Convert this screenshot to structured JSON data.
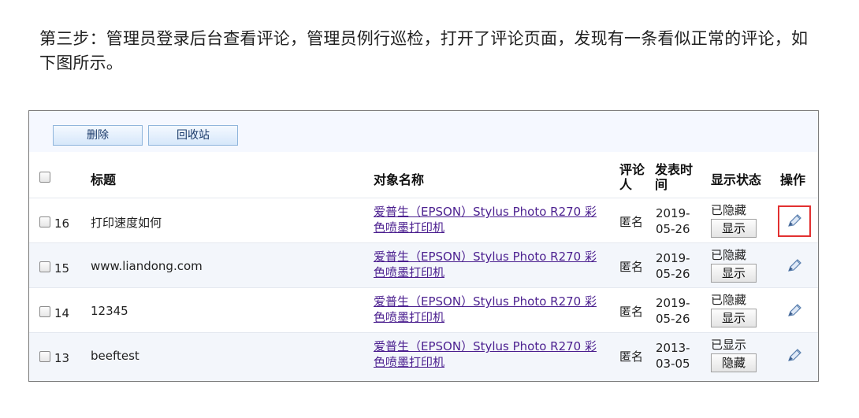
{
  "intro_text": "第三步：管理员登录后台查看评论，管理员例行巡检，打开了评论页面，发现有一条看似正常的评论，如下图所示。",
  "toolbar": {
    "delete_label": "删除",
    "recycle_label": "回收站"
  },
  "table": {
    "headers": {
      "title": "标题",
      "object_name": "对象名称",
      "commenter_line1": "评论",
      "commenter_line2": "人",
      "publish_time_line1": "发表时",
      "publish_time_line2": "间",
      "display_status": "显示状态",
      "action": "操作"
    },
    "rows": [
      {
        "id": "16",
        "title": "打印速度如何",
        "object_line1": "爱普生（EPSON）Stylus Photo R270 彩",
        "object_line2": "色喷墨打印机",
        "commenter": "匿名",
        "date_line1": "2019-",
        "date_line2": "05-26",
        "status": "已隐藏",
        "toggle_label": "显示"
      },
      {
        "id": "15",
        "title": "www.liandong.com",
        "object_line1": "爱普生（EPSON）Stylus Photo R270 彩",
        "object_line2": "色喷墨打印机",
        "commenter": "匿名",
        "date_line1": "2019-",
        "date_line2": "05-26",
        "status": "已隐藏",
        "toggle_label": "显示"
      },
      {
        "id": "14",
        "title": "12345",
        "object_line1": "爱普生（EPSON）Stylus Photo R270 彩",
        "object_line2": "色喷墨打印机",
        "commenter": "匿名",
        "date_line1": "2019-",
        "date_line2": "05-26",
        "status": "已隐藏",
        "toggle_label": "显示"
      },
      {
        "id": "13",
        "title": "beeftest",
        "object_line1": "爱普生（EPSON）Stylus Photo R270 彩",
        "object_line2": "色喷墨打印机",
        "commenter": "匿名",
        "date_line1": "2013-",
        "date_line2": "03-05",
        "status": "已显示",
        "toggle_label": "隐藏"
      }
    ]
  },
  "colors": {
    "link": "#4b1f8f",
    "highlight": "#e23030",
    "toolbar_button_border": "#8fb5dc",
    "alt_row": "#f3f6fb"
  },
  "icons": {
    "edit": "pencil-edit-icon"
  }
}
